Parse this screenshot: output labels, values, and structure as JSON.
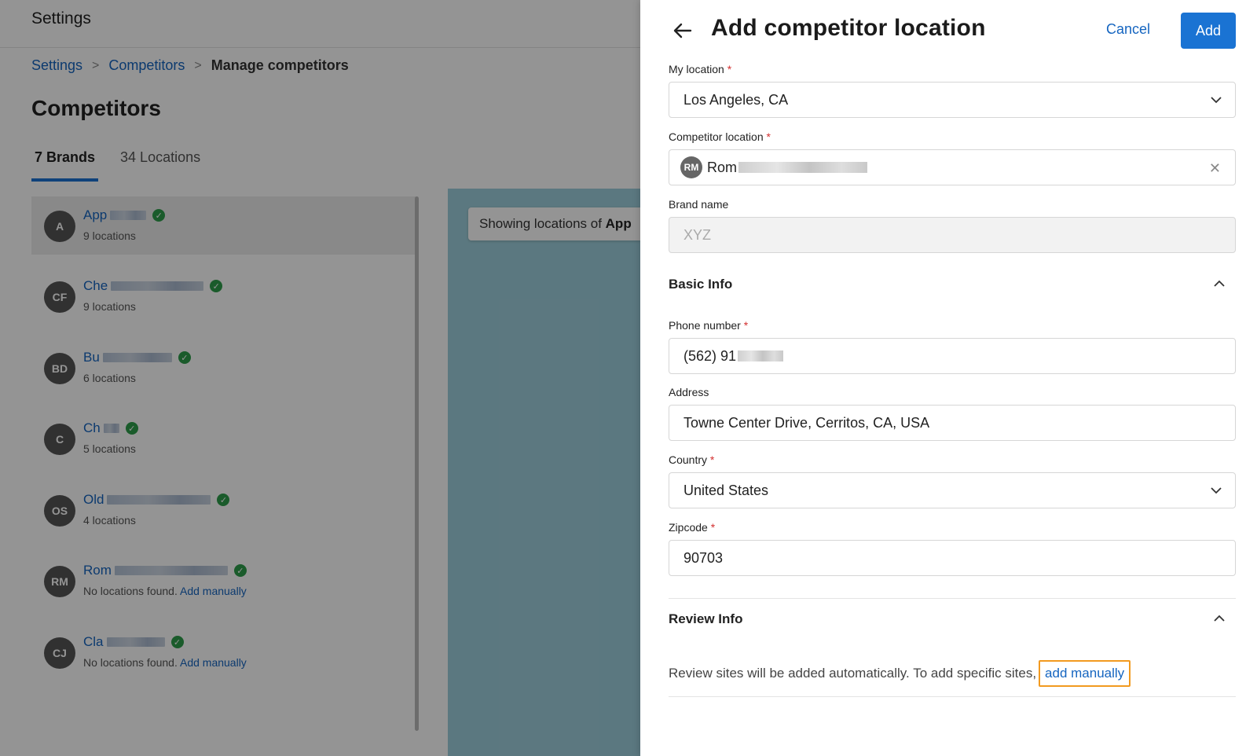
{
  "app": {
    "title": "Settings"
  },
  "breadcrumb": {
    "items": [
      "Settings",
      "Competitors"
    ],
    "separator": ">",
    "current": "Manage competitors"
  },
  "page": {
    "title": "Competitors"
  },
  "tabs": [
    {
      "label": "7 Brands",
      "active": true
    },
    {
      "label": "34 Locations",
      "active": false
    }
  ],
  "brands": [
    {
      "initials": "A",
      "name": "App",
      "sub": "9 locations",
      "add_link": "",
      "selected": true
    },
    {
      "initials": "CF",
      "name": "Che",
      "sub": "9 locations",
      "add_link": ""
    },
    {
      "initials": "BD",
      "name": "Bu",
      "sub": "6 locations",
      "add_link": ""
    },
    {
      "initials": "C",
      "name": "Ch",
      "sub": "5 locations",
      "add_link": ""
    },
    {
      "initials": "OS",
      "name": "Old",
      "sub": "4 locations",
      "add_link": ""
    },
    {
      "initials": "RM",
      "name": "Rom",
      "sub": "No locations found.",
      "add_link": "Add manually"
    },
    {
      "initials": "CJ",
      "name": "Cla",
      "sub": "No locations found.",
      "add_link": "Add manually"
    }
  ],
  "map": {
    "chip_prefix": "Showing locations of ",
    "chip_brand": "App"
  },
  "drawer": {
    "title": "Add competitor location",
    "cancel_label": "Cancel",
    "add_label": "Add",
    "required_mark": "*",
    "my_location": {
      "label": "My location",
      "value": "Los Angeles, CA"
    },
    "competitor_location": {
      "label": "Competitor location",
      "avatar": "RM",
      "value": "Rom"
    },
    "brand_name": {
      "label": "Brand name",
      "placeholder": "XYZ"
    },
    "basic_info": {
      "title": "Basic Info"
    },
    "phone": {
      "label": "Phone number",
      "value": "(562) 91"
    },
    "address": {
      "label": "Address",
      "value": "Towne Center Drive, Cerritos, CA, USA"
    },
    "country": {
      "label": "Country",
      "value": "United States"
    },
    "zipcode": {
      "label": "Zipcode",
      "value": "90703"
    },
    "review_info": {
      "title": "Review Info",
      "text": "Review sites will be added automatically. To add specific sites,",
      "link": "add manually"
    }
  },
  "colors": {
    "accent": "#1a73d3",
    "link": "#1565c0",
    "verified": "#2e9e4a",
    "required": "#d32f2f",
    "highlight": "#f29a1f"
  }
}
